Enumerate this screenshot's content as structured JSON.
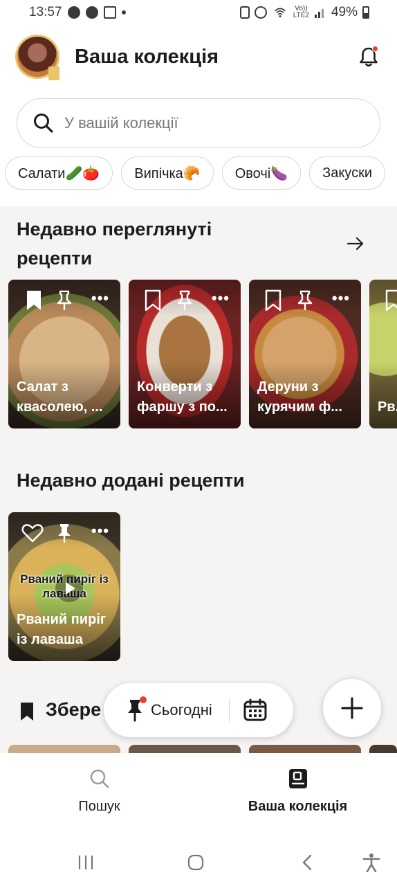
{
  "status_bar": {
    "time": "13:57",
    "battery": "49%",
    "net_top": "Vo))",
    "net_bottom": "LTE2"
  },
  "header": {
    "title": "Ваша колекція",
    "search_placeholder": "У вашій колекції"
  },
  "chips": [
    "Салати🥒🍅",
    "Випічка🥐",
    "Овочі🍆",
    "Закуски"
  ],
  "recent_viewed": {
    "title": "Недавно переглянуті рецепти",
    "cards": [
      {
        "name": "Салат з квасолею, ..."
      },
      {
        "name": "Конверти з фаршу з по..."
      },
      {
        "name": "Деруни з курячим ф..."
      },
      {
        "name": "Рв... із л..."
      }
    ]
  },
  "recent_added": {
    "title": "Недавно додані рецепти",
    "cards": [
      {
        "name": "Рваний пиріг із лаваша",
        "video_caption": "Рваний пиріг із лаваша"
      }
    ]
  },
  "saved": {
    "title_visible": "Збере"
  },
  "floating_bar": {
    "today_label": "Сьогодні"
  },
  "bottom_nav": {
    "search_label": "Пошук",
    "collection_label": "Ваша колекція"
  },
  "colors": {
    "accent_red": "#e5432b",
    "avatar_ring": "#e8c46a",
    "background": "#f5f4f2"
  }
}
